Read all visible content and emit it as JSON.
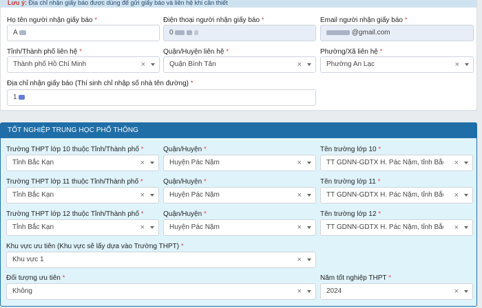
{
  "notice": {
    "label": "Lưu ý:",
    "text": "Địa chỉ nhận giấy báo được dùng để gửi giấy báo và liên hệ khi cần thiết"
  },
  "receiver": {
    "name": {
      "label": "Họ tên người nhận giấy báo",
      "value": "A"
    },
    "phone": {
      "label": "Điện thoại người nhận giấy báo",
      "value": "0"
    },
    "email": {
      "label": "Email người nhận giấy báo",
      "value": "@gmail.com"
    },
    "province": {
      "label": "Tỉnh/Thành phố liên hệ",
      "value": "Thành phố Hồ Chí Minh"
    },
    "district": {
      "label": "Quận/Huyện liên hệ",
      "value": "Quận Bình Tân"
    },
    "ward": {
      "label": "Phường/Xã liên hệ",
      "value": "Phường An Lạc"
    },
    "address": {
      "label": "Địa chỉ nhận giấy báo (Thí sinh chỉ nhập số nhà tên đường)",
      "value": "1"
    }
  },
  "graduation": {
    "title": "TỐT NGHIỆP TRUNG HỌC PHỔ THÔNG",
    "rows": [
      {
        "province_label": "Trường THPT lớp 10 thuộc Tỉnh/Thành phố",
        "province_value": "Tỉnh Bắc Kạn",
        "district_label": "Quận/Huyện",
        "district_value": "Huyện Pác Nặm",
        "school_label": "Tên trường lớp 10",
        "school_value": "TT GDNN-GDTX H. Pác Nặm, tỉnh Bắc Kạn"
      },
      {
        "province_label": "Trường THPT lớp 11 thuộc Tỉnh/Thành phố",
        "province_value": "Tỉnh Bắc Kạn",
        "district_label": "Quận/Huyện",
        "district_value": "Huyện Pác Nặm",
        "school_label": "Tên trường lớp 11",
        "school_value": "TT GDNN-GDTX H. Pác Nặm, tỉnh Bắc Kạn"
      },
      {
        "province_label": "Trường THPT lớp 12 thuộc Tỉnh/Thành phố",
        "province_value": "Tỉnh Bắc Kạn",
        "district_label": "Quận/Huyện",
        "district_value": "Huyện Pác Nặm",
        "school_label": "Tên trường lớp 12",
        "school_value": "TT GDNN-GDTX H. Pác Nặm, tỉnh Bắc Kạn"
      }
    ],
    "priority_area": {
      "label": "Khu vực ưu tiên (Khu vực sẽ lấy dựa vào Trường THPT)",
      "value": "Khu vực 1"
    },
    "priority_group": {
      "label": "Đối tượng ưu tiên",
      "value": "Không"
    },
    "grad_year": {
      "label": "Năm tốt nghiệp THPT",
      "value": "2024"
    }
  },
  "icons": {
    "clear": "×",
    "caret": "chevron-down-icon"
  },
  "required_mark": "*",
  "colors": {
    "header": "#1f6ea8",
    "section_bg": "#dff3fb",
    "required": "#d9534f"
  }
}
